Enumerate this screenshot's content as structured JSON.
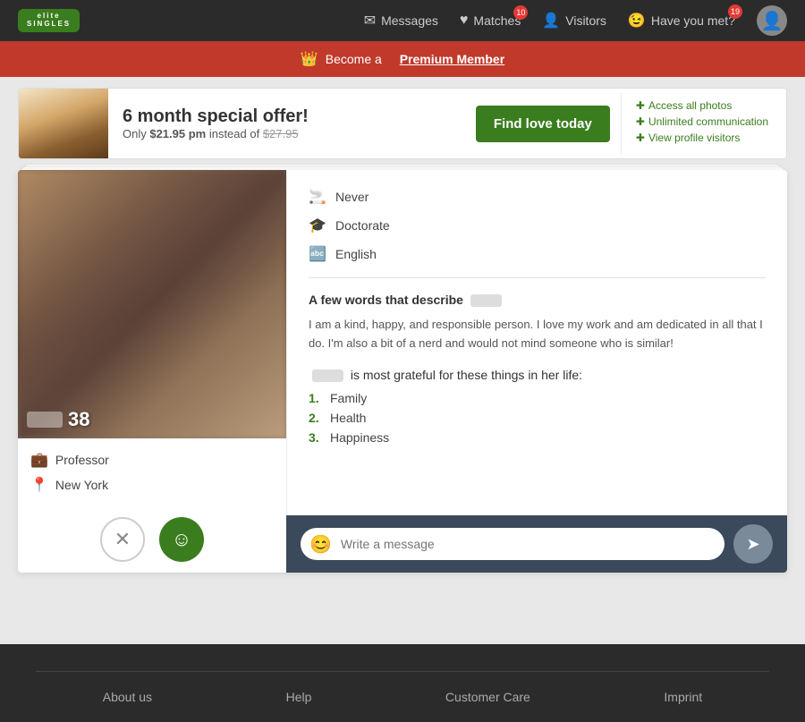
{
  "header": {
    "logo_line1": "elite",
    "logo_line2": "SINGLES",
    "nav": {
      "messages_label": "Messages",
      "matches_label": "Matches",
      "matches_badge": "10",
      "visitors_label": "Visitors",
      "have_you_met_label": "Have you met?",
      "have_you_met_badge": "19"
    }
  },
  "premium_banner": {
    "text": "Become a",
    "link_text": "Premium Member"
  },
  "ad_banner": {
    "offer_heading": "6 month special offer!",
    "price_text": "Only $21.95 pm instead of $27.95",
    "cta_label": "Find love today",
    "feature1": "Access all photos",
    "feature2": "Unlimited communication",
    "feature3": "View profile visitors"
  },
  "profile": {
    "age": "38",
    "job": "Professor",
    "location": "New York",
    "smoking": "Never",
    "education": "Doctorate",
    "language": "English",
    "description_title": "A few words that describe",
    "description_body": "I am a kind, happy, and responsible person. I love my work and am dedicated in all that I do. I'm also a bit of a nerd and would not mind someone who is similar!",
    "grateful_title": "is most grateful for these things in her life:",
    "grateful_items": [
      {
        "number": "1.",
        "item": "Family"
      },
      {
        "number": "2.",
        "item": "Health"
      },
      {
        "number": "3.",
        "item": "Happiness"
      }
    ]
  },
  "message": {
    "placeholder": "Write a message"
  },
  "footer": {
    "about": "About us",
    "help": "Help",
    "customer_care": "Customer Care",
    "imprint": "Imprint"
  }
}
